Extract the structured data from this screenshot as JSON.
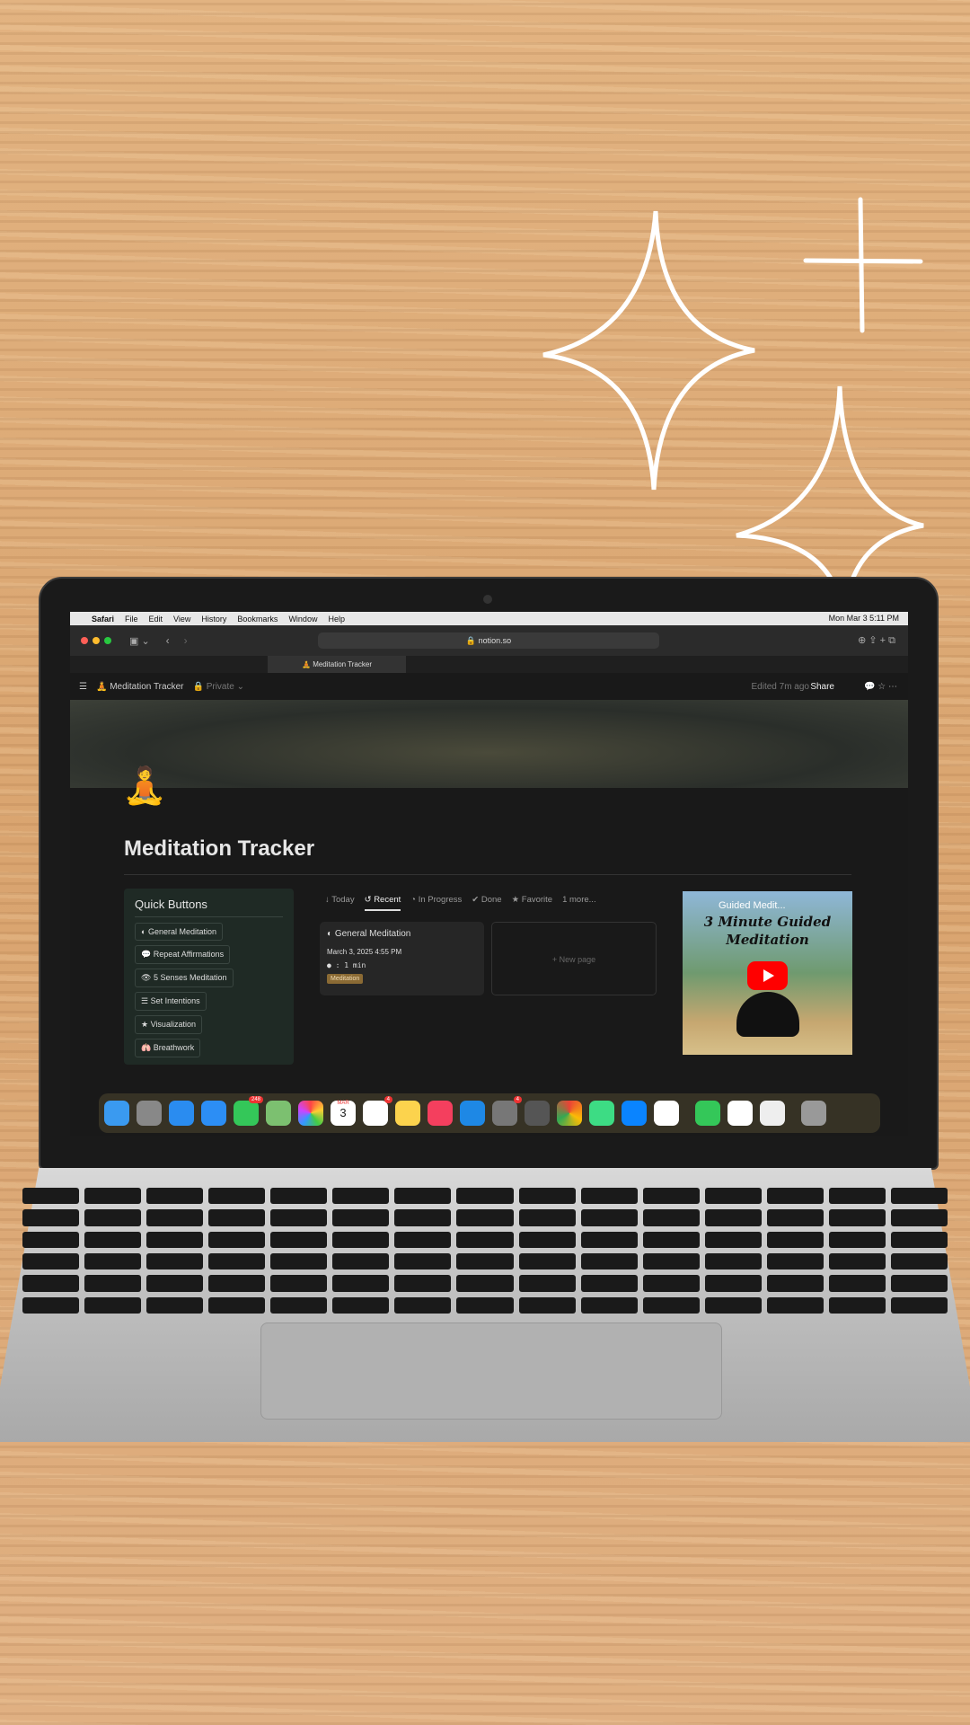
{
  "menubar": {
    "app": "Safari",
    "items": [
      "File",
      "Edit",
      "View",
      "History",
      "Bookmarks",
      "Window",
      "Help"
    ],
    "clock": "Mon Mar 3  5:11 PM"
  },
  "browser": {
    "url": "notion.so",
    "tab_title": "Meditation Tracker"
  },
  "notion": {
    "breadcrumb": "Meditation Tracker",
    "privacy": "Private",
    "edited": "Edited 7m ago",
    "share": "Share",
    "page_icon": "🧘",
    "title": "Meditation Tracker"
  },
  "quick_buttons": {
    "heading": "Quick Buttons",
    "items": [
      {
        "icon": "◐",
        "label": "General Meditation"
      },
      {
        "icon": "💬",
        "label": "Repeat Affirmations"
      },
      {
        "icon": "👁",
        "label": "5 Senses Meditation"
      },
      {
        "icon": "☰",
        "label": "Set Intentions"
      },
      {
        "icon": "★",
        "label": "Visualization"
      },
      {
        "icon": "🫁",
        "label": "Breathwork"
      }
    ]
  },
  "views": {
    "tabs": [
      {
        "icon": "↓",
        "label": "Today"
      },
      {
        "icon": "↺",
        "label": "Recent"
      },
      {
        "icon": "◔",
        "label": "In Progress"
      },
      {
        "icon": "✔",
        "label": "Done"
      },
      {
        "icon": "★",
        "label": "Favorite"
      }
    ],
    "more": "1 more...",
    "active": "Recent"
  },
  "card": {
    "title": "General Meditation",
    "date": "March 3, 2025 4:55 PM",
    "duration": ": 1 min",
    "tag": "Meditation"
  },
  "new_page": "+ New page",
  "video": {
    "channel_title": "Guided Medit...",
    "thumb_text": "3 Minute Guided Meditation"
  },
  "dock": {
    "badges": {
      "messages": "248",
      "reminders": "4",
      "settings": "4"
    },
    "calendar_month": "MAR",
    "calendar_day": "3"
  },
  "colors": {
    "tag": "#8a6a34",
    "panel": "#1f2a25",
    "youtube": "#ff0000"
  }
}
